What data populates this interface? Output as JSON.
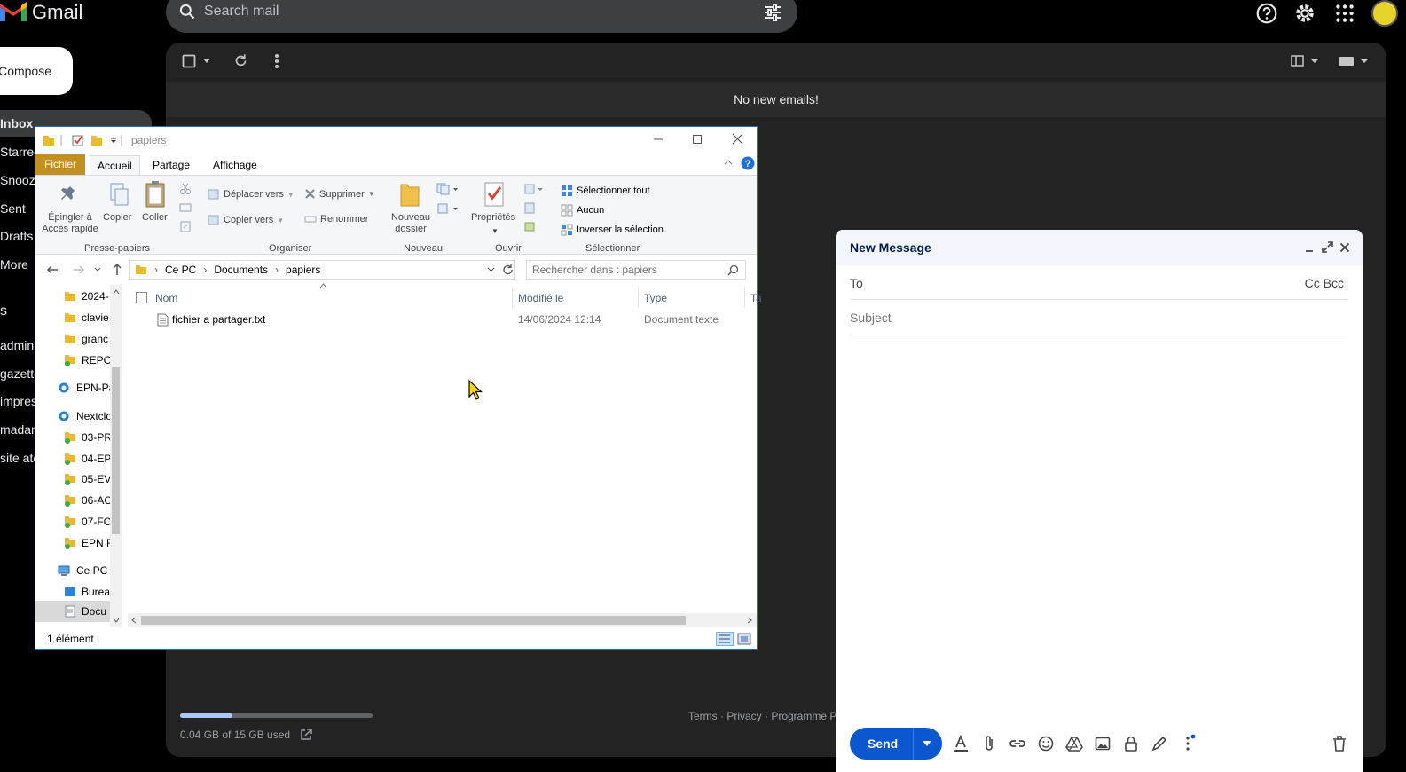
{
  "gmail": {
    "brand": "Gmail",
    "search_placeholder": "Search mail",
    "compose_label": "Compose",
    "sidebar": [
      "Inbox",
      "Starred",
      "Snoozed",
      "Sent",
      "Drafts",
      "More"
    ],
    "labels_heading": "s",
    "labels": [
      "admin",
      "gazette",
      "impress",
      "madam",
      "site ate"
    ],
    "no_new": "No new emails!",
    "storage": "0.04 GB of 15 GB used",
    "footer": "Terms · Privacy · Programme Po",
    "storage_fraction": 0.27
  },
  "explorer": {
    "title": "papiers",
    "tabs": {
      "file": "Fichier",
      "home": "Accueil",
      "share": "Partage",
      "view": "Affichage"
    },
    "ribbon": {
      "pin": "Épingler à\nAccès rapide",
      "copy": "Copier",
      "paste": "Coller",
      "move_to": "Déplacer vers",
      "copy_to": "Copier vers",
      "delete": "Supprimer",
      "rename": "Renommer",
      "new_folder": "Nouveau\ndossier",
      "properties": "Propriétés",
      "select_all": "Sélectionner tout",
      "select_none": "Aucun",
      "invert_selection": "Inverser la sélection",
      "groups": {
        "clipboard": "Presse-papiers",
        "organize": "Organiser",
        "new": "Nouveau",
        "open": "Ouvrir",
        "select": "Sélectionner"
      }
    },
    "address": [
      "Ce PC",
      "Documents",
      "papiers"
    ],
    "search_placeholder": "Rechercher dans : papiers",
    "nav": [
      "2024-",
      "clavie",
      "granc",
      "REPO",
      "EPN-Pa",
      "Nextclo",
      "03-PR",
      "04-EP",
      "05-EV",
      "06-AC",
      "07-FC",
      "EPN F",
      "Ce PC",
      "Burea",
      "Docu"
    ],
    "columns": {
      "name": "Nom",
      "modified": "Modifié le",
      "type": "Type",
      "size": "Ta"
    },
    "files": [
      {
        "name": "fichier a partager.txt",
        "modified": "14/06/2024 12:14",
        "type": "Document texte"
      }
    ],
    "status": "1 élément"
  },
  "compose": {
    "title": "New Message",
    "to_label": "To",
    "cc_bcc": "Cc Bcc",
    "subject_placeholder": "Subject",
    "send_label": "Send"
  },
  "colors": {
    "gmail_bg": "#000000",
    "panel": "#232323",
    "send": "#0b57d0",
    "file_tab": "#c29020"
  }
}
